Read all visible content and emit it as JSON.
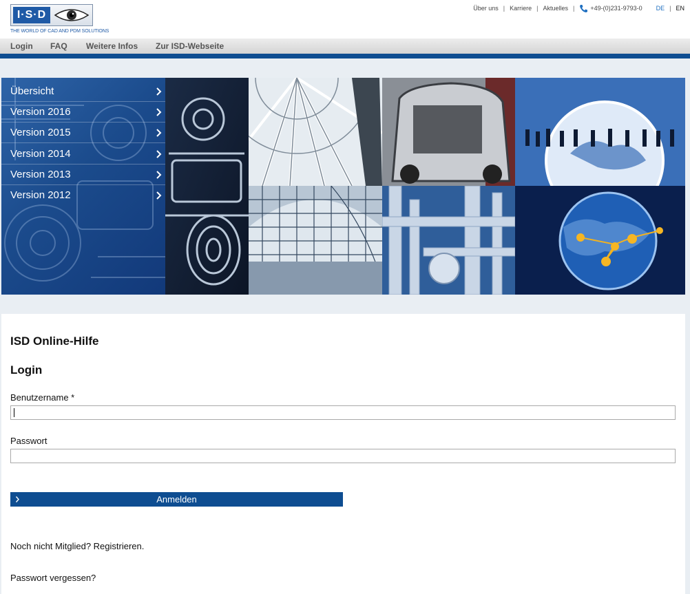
{
  "brand": {
    "logo_text": "I·S·D",
    "tagline": "THE WORLD OF CAD AND PDM SOLUTIONS"
  },
  "topnav": {
    "links": [
      "Über uns",
      "Karriere",
      "Aktuelles"
    ],
    "phone": "+49-(0)231-9793-0",
    "lang_de": "DE",
    "lang_en": "EN"
  },
  "mainnav": {
    "items": [
      "Login",
      "FAQ",
      "Weitere Infos",
      "Zur ISD-Webseite"
    ]
  },
  "sidemenu": {
    "items": [
      "Übersicht",
      "Version 2016",
      "Version 2015",
      "Version 2014",
      "Version 2013",
      "Version 2012"
    ]
  },
  "content": {
    "title": "ISD Online-Hilfe",
    "login_heading": "Login",
    "username_label": "Benutzername *",
    "username_value": "",
    "password_label": "Passwort",
    "password_value": "",
    "submit_label": "Anmelden",
    "register_link": "Noch nicht Mitglied? Registrieren.",
    "forgot_link": "Passwort vergessen?"
  },
  "colors": {
    "brand_blue": "#0e4d91",
    "link_blue": "#1f6fc0",
    "page_bg": "#e9eef3"
  }
}
